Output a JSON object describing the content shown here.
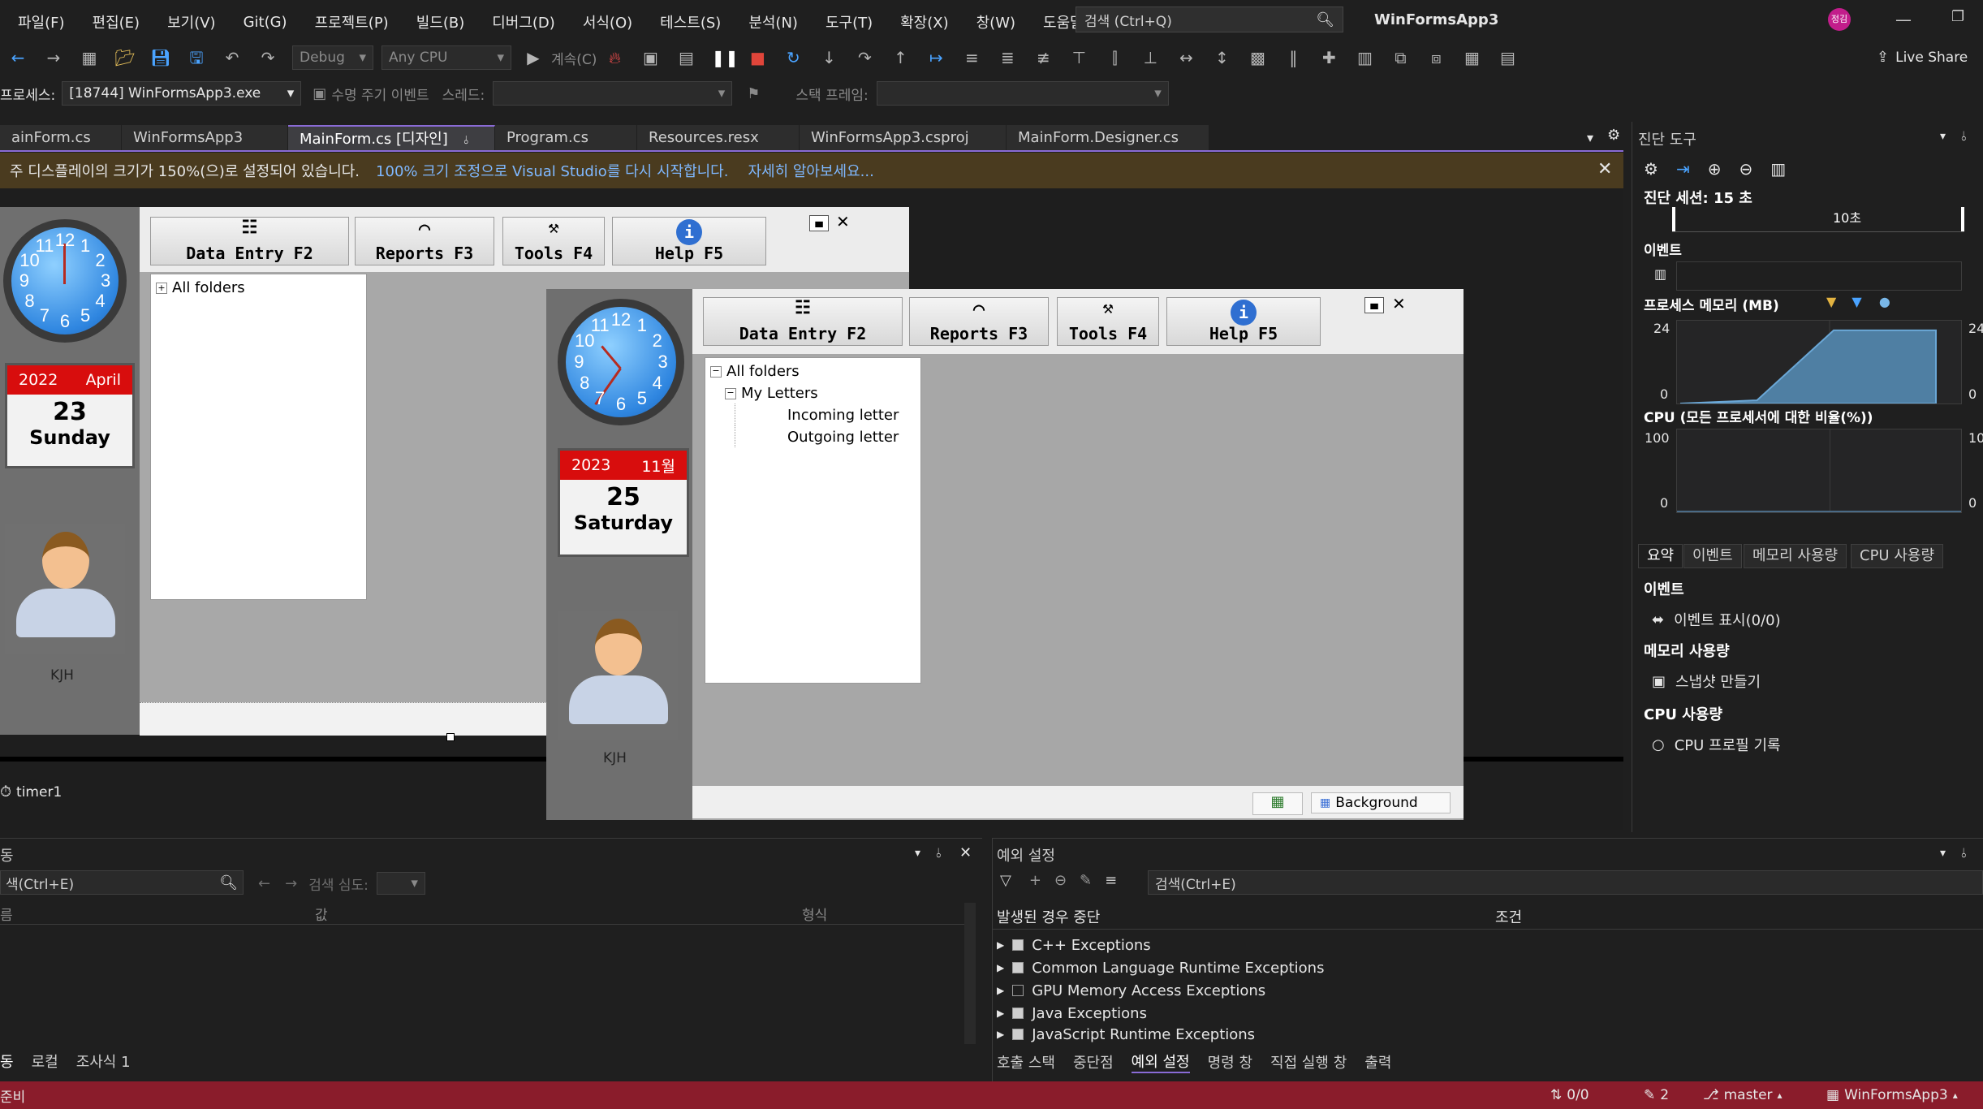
{
  "menu": [
    "파일(F)",
    "편집(E)",
    "보기(V)",
    "Git(G)",
    "프로젝트(P)",
    "빌드(B)",
    "디버그(D)",
    "서식(O)",
    "테스트(S)",
    "분석(N)",
    "도구(T)",
    "확장(X)",
    "창(W)",
    "도움말(H)"
  ],
  "search": {
    "placeholder": "검색 (Ctrl+Q)"
  },
  "app_title": "WinFormsApp3",
  "user_initials": "정김",
  "toolbar": {
    "config": "Debug",
    "platform": "Any CPU",
    "continue_label": "계속(C)",
    "live_share": "Live Share"
  },
  "debugbar": {
    "process_label": "프로세스:",
    "process_value": "[18744] WinFormsApp3.exe",
    "lifecycle": "수명 주기 이벤트",
    "thread_label": "스레드:",
    "stackframe_label": "스택 프레임:"
  },
  "tabs": [
    "ainForm.cs",
    "WinFormsApp3",
    "MainForm.cs [디자인]",
    "Program.cs",
    "Resources.resx",
    "WinFormsApp3.csproj",
    "MainForm.Designer.cs"
  ],
  "infobar": {
    "message": "주 디스플레이의 크기가 150%(으)로 설정되어 있습니다.",
    "link1": "100% 크기 조정으로 Visual Studio를 다시 시작합니다.",
    "link2": "자세히 알아보세요..."
  },
  "form": {
    "buttons": [
      "Data Entry F2",
      "Reports F3",
      "Tools F4",
      "Help F5"
    ],
    "tree_root": "All folders",
    "tree_children": [
      "My Letters"
    ],
    "tree_leaves": [
      "Incoming letter",
      "Outgoing letter"
    ],
    "user_name": "KJH",
    "status_background": "Background"
  },
  "clock_numbers": [
    "12",
    "1",
    "2",
    "3",
    "4",
    "5",
    "6",
    "7",
    "8",
    "9",
    "10",
    "11"
  ],
  "calendar_back": {
    "year": "2022",
    "month": "April",
    "day": "23",
    "weekday": "Sunday"
  },
  "calendar_front": {
    "year": "2023",
    "month": "11월",
    "day": "25",
    "weekday": "Saturday"
  },
  "component_tray": {
    "timer": "timer1"
  },
  "diag": {
    "title": "진단 도구",
    "session": "진단 세션: 15 초",
    "timeline_tick": "10초",
    "events_label": "이벤트",
    "memory_label": "프로세스 메모리 (MB)",
    "memory_max": "24",
    "memory_min": "0",
    "cpu_label": "CPU (모든 프로세서에 대한 비율(%))",
    "cpu_max": "100",
    "cpu_min": "0",
    "memory_plot": [
      {
        "t": 0,
        "mb": 0
      },
      {
        "t": 0.3,
        "mb": 1
      },
      {
        "t": 0.6,
        "mb": 23
      },
      {
        "t": 1,
        "mb": 23
      }
    ],
    "tabs": [
      "요약",
      "이벤트",
      "메모리 사용량",
      "CPU 사용량"
    ],
    "sum_events_head": "이벤트",
    "sum_events_item": "이벤트 표시(0/0)",
    "sum_mem_head": "메모리 사용량",
    "sum_mem_item": "스냅샷 만들기",
    "sum_cpu_head": "CPU 사용량",
    "sum_cpu_item": "CPU 프로필 기록"
  },
  "locals": {
    "title": "동",
    "search": "색(Ctrl+E)",
    "depth_label": "검색 심도:",
    "col_name": "름",
    "col_value": "값",
    "col_type": "형식",
    "tabs": [
      "동",
      "로컬",
      "조사식 1"
    ]
  },
  "exceptions": {
    "title": "예외 설정",
    "search": "검색(Ctrl+E)",
    "col_break": "발생된 경우 중단",
    "col_cond": "조건",
    "items": [
      {
        "label": "C++ Exceptions",
        "checked": true
      },
      {
        "label": "Common Language Runtime Exceptions",
        "checked": true
      },
      {
        "label": "GPU Memory Access Exceptions",
        "checked": false
      },
      {
        "label": "Java Exceptions",
        "checked": true
      },
      {
        "label": "JavaScript Runtime Exceptions",
        "checked": true
      }
    ],
    "tabs": [
      "호출 스택",
      "중단점",
      "예외 설정",
      "명령 창",
      "직접 실행 창",
      "출력"
    ]
  },
  "statusbar": {
    "ready": "준비",
    "updown": "0/0",
    "edits": "2",
    "branch": "master",
    "project": "WinFormsApp3"
  },
  "colors": {
    "statusbar": "#8a1c2b",
    "accent": "#8a6bd6",
    "infobar": "#4a3b1f"
  }
}
